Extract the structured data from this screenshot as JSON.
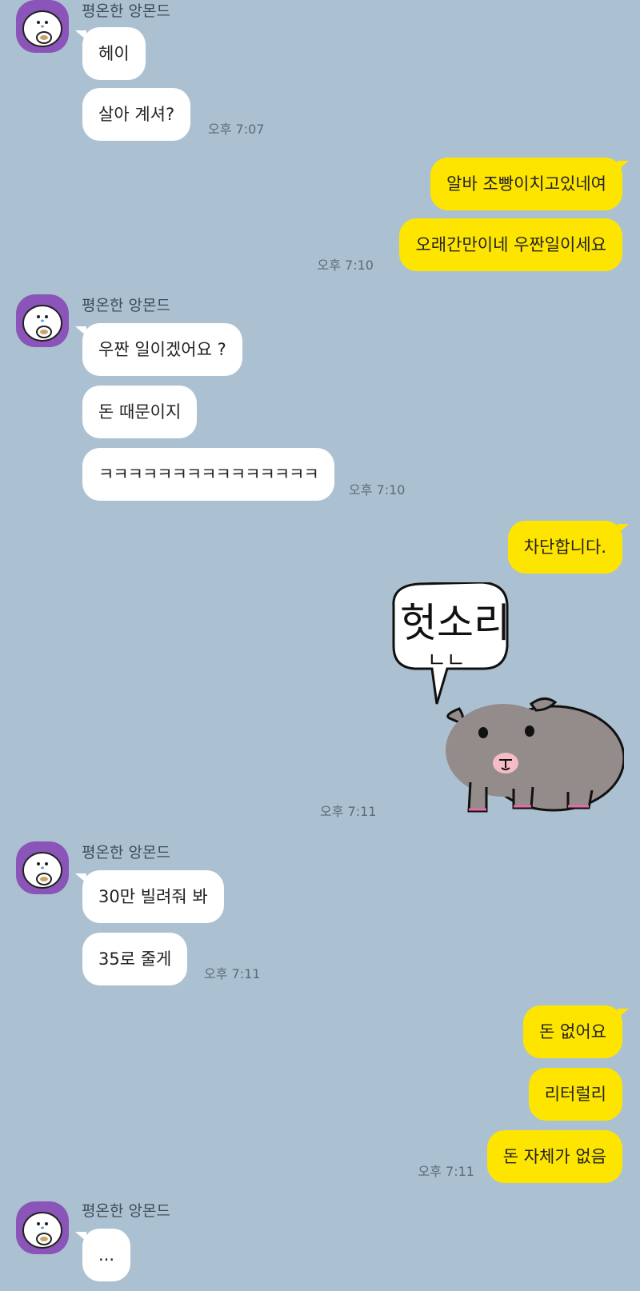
{
  "contact": {
    "name": "평온한 앙몬드"
  },
  "groups": [
    {
      "name": "평온한 앙몬드",
      "messages": [
        "헤이",
        "살아 계셔?"
      ],
      "time": "오후 7:07"
    },
    {
      "messages": [
        "알바 조빵이치고있네여",
        "오래간만이네 우짠일이세요"
      ],
      "time": "오후 7:10"
    },
    {
      "name": "평온한 앙몬드",
      "messages": [
        "우짠 일이겠어요 ?",
        "돈 때문이지",
        "ㅋㅋㅋㅋㅋㅋㅋㅋㅋㅋㅋㅋㅋㅋㅋ"
      ],
      "time": "오후 7:10"
    },
    {
      "messages": [
        "차단합니다."
      ]
    },
    {
      "sticker": {
        "text": "헛소리",
        "sub": "ㄴㄴ",
        "icon": "guinea-pig-sticker"
      },
      "time": "오후 7:11"
    },
    {
      "name": "평온한 앙몬드",
      "messages": [
        "30만 빌려줘 봐",
        "35로 줄게"
      ],
      "time": "오후 7:11"
    },
    {
      "messages": [
        "돈 없어요",
        "리터럴리",
        "돈 자체가 없음"
      ],
      "time": "오후 7:11"
    },
    {
      "name": "평온한 앙몬드",
      "messages": [
        "..."
      ]
    }
  ],
  "colors": {
    "background": "#abc1d1",
    "incoming": "#ffffff",
    "outgoing": "#fee500",
    "avatar": "#8a54b8"
  }
}
